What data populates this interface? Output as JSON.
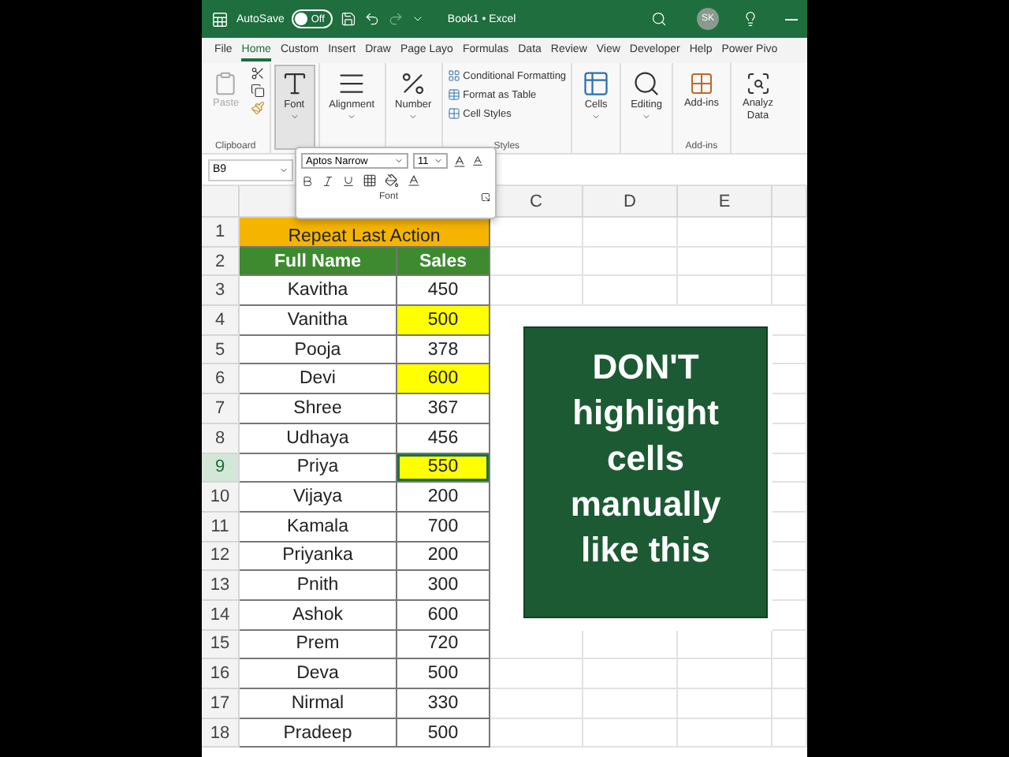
{
  "title_bar": {
    "autosave_label": "AutoSave",
    "autosave_toggle": {
      "label": "Off",
      "on": false
    },
    "document_title": "Book1 • Excel",
    "avatar": "SK"
  },
  "tabs": [
    {
      "label": "File",
      "selected": false
    },
    {
      "label": "Home",
      "selected": true
    },
    {
      "label": "Custom",
      "selected": false
    },
    {
      "label": "Insert",
      "selected": false
    },
    {
      "label": "Draw",
      "selected": false
    },
    {
      "label": "Page Layo",
      "selected": false
    },
    {
      "label": "Formulas",
      "selected": false
    },
    {
      "label": "Data",
      "selected": false
    },
    {
      "label": "Review",
      "selected": false
    },
    {
      "label": "View",
      "selected": false
    },
    {
      "label": "Developer",
      "selected": false
    },
    {
      "label": "Help",
      "selected": false
    },
    {
      "label": "Power Pivo",
      "selected": false
    }
  ],
  "ribbon": {
    "clipboard": {
      "paste": "Paste",
      "label": "Clipboard"
    },
    "collapsed_groups": [
      {
        "kind": "font",
        "label": "Font",
        "selected": true
      },
      {
        "kind": "alignment",
        "label": "Alignment",
        "selected": false
      },
      {
        "kind": "number",
        "label": "Number",
        "selected": false
      }
    ],
    "styles": {
      "items": [
        "Conditional Formatting",
        "Format as Table",
        "Cell Styles"
      ],
      "label": "Styles"
    },
    "more_groups": [
      {
        "kind": "cells",
        "label": "Cells"
      },
      {
        "kind": "editing",
        "label": "Editing"
      }
    ],
    "addins": {
      "button": "Add-ins",
      "label": "Add-ins"
    },
    "analyze": {
      "line_1": "Analyz",
      "line_2": "Data"
    }
  },
  "name_box": "B9",
  "font_popup": {
    "font_name": "Aptos Narrow",
    "font_size": "11",
    "label": "Font"
  },
  "columns": [
    "C",
    "D",
    "E"
  ],
  "title_row": {
    "number": "1",
    "text": "Repeat Last Action"
  },
  "header_row": {
    "number": "2",
    "cells": [
      "Full Name",
      "Sales"
    ]
  },
  "rows": [
    {
      "number": "3",
      "name": "Kavitha",
      "sales": "450",
      "highlighted": false,
      "selected": false
    },
    {
      "number": "4",
      "name": "Vanitha",
      "sales": "500",
      "highlighted": true,
      "selected": false
    },
    {
      "number": "5",
      "name": "Pooja",
      "sales": "378",
      "highlighted": false,
      "selected": false
    },
    {
      "number": "6",
      "name": "Devi",
      "sales": "600",
      "highlighted": true,
      "selected": false
    },
    {
      "number": "7",
      "name": "Shree",
      "sales": "367",
      "highlighted": false,
      "selected": false
    },
    {
      "number": "8",
      "name": "Udhaya",
      "sales": "456",
      "highlighted": false,
      "selected": false
    },
    {
      "number": "9",
      "name": "Priya",
      "sales": "550",
      "highlighted": true,
      "selected": true
    },
    {
      "number": "10",
      "name": "Vijaya",
      "sales": "200",
      "highlighted": false,
      "selected": false
    },
    {
      "number": "11",
      "name": "Kamala",
      "sales": "700",
      "highlighted": false,
      "selected": false
    },
    {
      "number": "12",
      "name": "Priyanka",
      "sales": "200",
      "highlighted": false,
      "selected": false
    },
    {
      "number": "13",
      "name": "Pnith",
      "sales": "300",
      "highlighted": false,
      "selected": false
    },
    {
      "number": "14",
      "name": "Ashok",
      "sales": "600",
      "highlighted": false,
      "selected": false
    },
    {
      "number": "15",
      "name": "Prem",
      "sales": "720",
      "highlighted": false,
      "selected": false
    },
    {
      "number": "16",
      "name": "Deva",
      "sales": "500",
      "highlighted": false,
      "selected": false
    },
    {
      "number": "17",
      "name": "Nirmal",
      "sales": "330",
      "highlighted": false,
      "selected": false
    },
    {
      "number": "18",
      "name": "Pradeep",
      "sales": "500",
      "highlighted": false,
      "selected": false
    }
  ],
  "callout": "DON'T highlight cells manually like this"
}
